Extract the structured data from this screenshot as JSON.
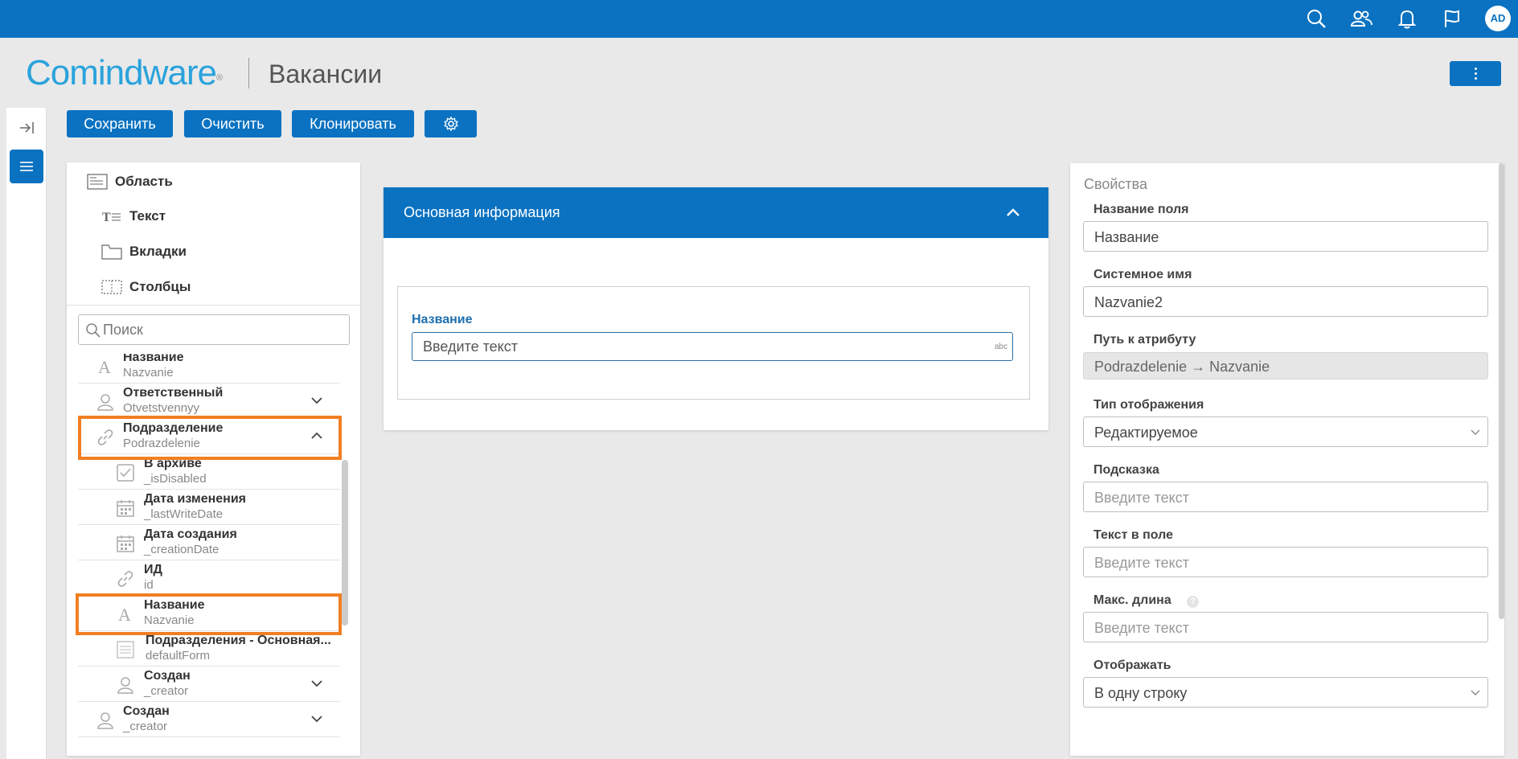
{
  "topbar": {
    "icons": [
      "search-icon",
      "users-icon",
      "bell-icon",
      "flag-icon"
    ],
    "avatar": "AD"
  },
  "header": {
    "logo": "Comindware",
    "app_title": "Вакансии"
  },
  "toolbar": {
    "save": "Сохранить",
    "clear": "Очистить",
    "clone": "Клонировать"
  },
  "toolbox": {
    "items": [
      {
        "label": "Область",
        "icon": "area-icon"
      },
      {
        "label": "Текст",
        "icon": "text-icon"
      },
      {
        "label": "Вкладки",
        "icon": "tabs-icon"
      },
      {
        "label": "Столбцы",
        "icon": "columns-icon"
      }
    ],
    "search_placeholder": "Поиск"
  },
  "attributes": [
    {
      "name": "Название",
      "system": "Nazvanie",
      "icon": "text-type-icon",
      "level": 0
    },
    {
      "name": "Ответственный",
      "system": "Otvetstvennyy",
      "icon": "user-icon",
      "level": 0,
      "expand": "down"
    },
    {
      "name": "Подразделение",
      "system": "Podrazdelenie",
      "icon": "link-icon",
      "level": 0,
      "expand": "up",
      "highlighted": true
    },
    {
      "name": "В архиве",
      "system": "_isDisabled",
      "icon": "checkbox-icon",
      "level": 1
    },
    {
      "name": "Дата изменения",
      "system": "_lastWriteDate",
      "icon": "calendar-icon",
      "level": 1
    },
    {
      "name": "Дата создания",
      "system": "_creationDate",
      "icon": "calendar-icon",
      "level": 1
    },
    {
      "name": "ИД",
      "system": "id",
      "icon": "link-icon",
      "level": 1
    },
    {
      "name": "Название",
      "system": "Nazvanie",
      "icon": "text-type-icon",
      "level": 1,
      "highlighted": true
    },
    {
      "name": "Подразделения - Основная...",
      "system": "defaultForm",
      "icon": "form-icon",
      "level": 1
    },
    {
      "name": "Создан",
      "system": "_creator",
      "icon": "user-icon",
      "level": 1,
      "expand": "down"
    },
    {
      "name": "Создан",
      "system": "_creator",
      "icon": "user-icon",
      "level": 0,
      "expand": "down"
    }
  ],
  "form": {
    "section_title": "Основная информация",
    "field_label": "Название",
    "field_placeholder": "Введите текст",
    "field_type_badge": "abc"
  },
  "properties": {
    "title": "Свойства",
    "field_name_label": "Название поля",
    "field_name_value": "Название",
    "system_name_label": "Системное имя",
    "system_name_value": "Nazvanie2",
    "attr_path_label": "Путь к атрибуту",
    "attr_path_value": "Podrazdelenie → Nazvanie",
    "display_type_label": "Тип отображения",
    "display_type_value": "Редактируемое",
    "hint_label": "Подсказка",
    "hint_placeholder": "Введите текст",
    "text_label": "Текст в поле",
    "text_placeholder": "Введите текст",
    "maxlen_label": "Макс. длина",
    "maxlen_placeholder": "Введите текст",
    "show_label": "Отображать",
    "show_value": "В одну строку"
  },
  "colors": {
    "primary": "#0a72c1",
    "highlight": "#f17f22",
    "logo": "#2aa3dc"
  }
}
